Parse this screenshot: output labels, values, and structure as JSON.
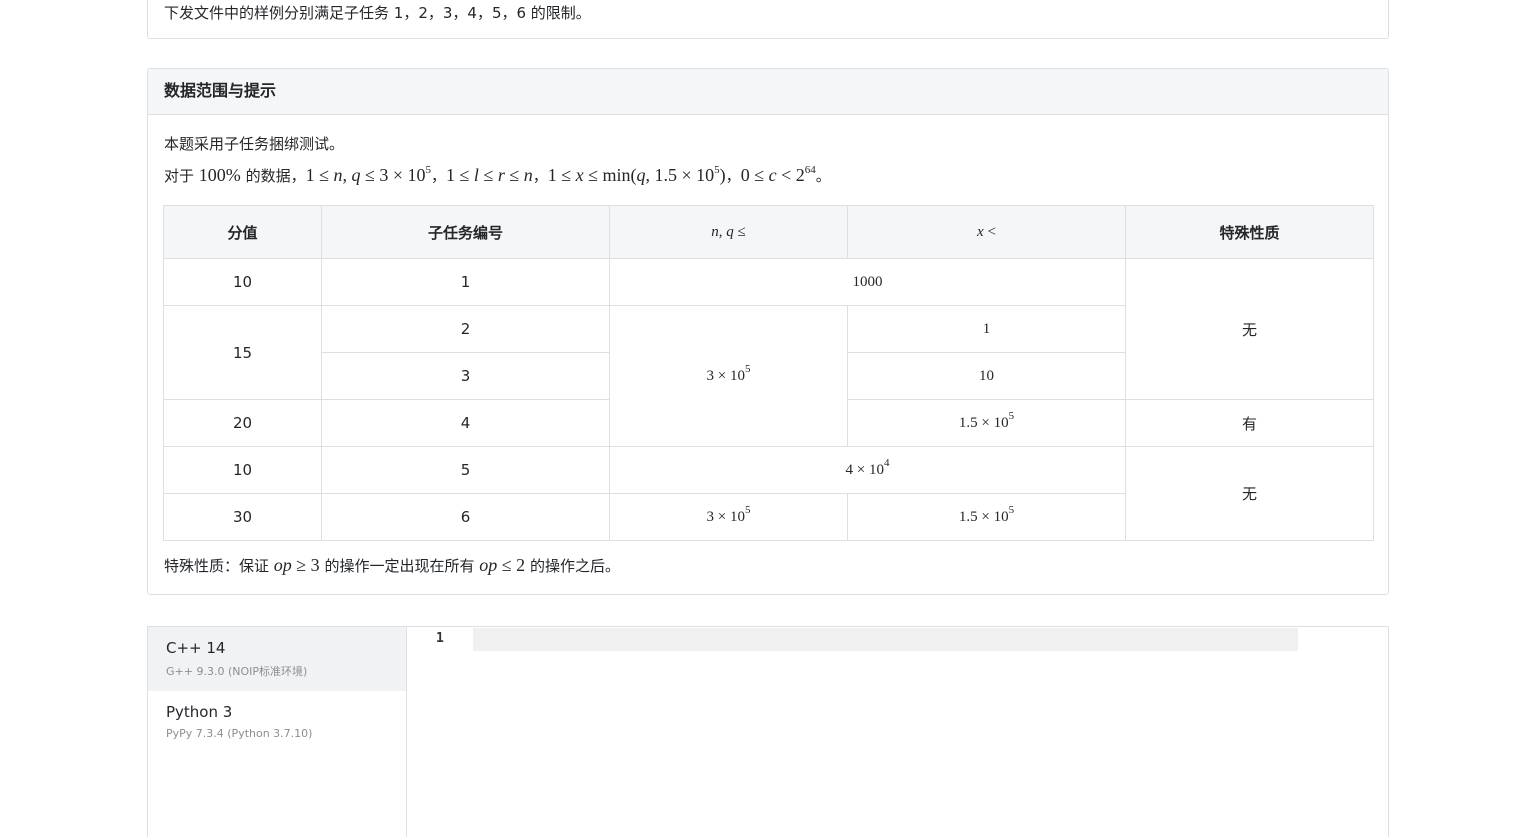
{
  "top_section": {
    "sample_note": "下发文件中的样例分别满足子任务 1，2，3，4，5，6 的限制。"
  },
  "data_range": {
    "heading": "数据范围与提示",
    "intro": "本题采用子任务捆绑测试。",
    "constraints_prefix": "对于",
    "constraints_percent": "100%",
    "constraints_mid": "的数据，",
    "special_note_prefix": "特殊性质：保证",
    "special_note_mid": "的操作一定出现在所有",
    "special_note_suffix": "的操作之后。",
    "table": {
      "headers": [
        "分值",
        "子任务编号",
        "n,q ≤",
        "x <",
        "特殊性质"
      ],
      "rows": [
        {
          "score": "10",
          "id": "1",
          "nq": "1000",
          "x": "",
          "special": "无"
        },
        {
          "score": "15",
          "id": "2",
          "nq": "3 × 10^5",
          "x": "1",
          "special": ""
        },
        {
          "score": "",
          "id": "3",
          "nq": "",
          "x": "10",
          "special": ""
        },
        {
          "score": "20",
          "id": "4",
          "nq": "",
          "x": "1.5 × 10^5",
          "special": "有"
        },
        {
          "score": "10",
          "id": "5",
          "nq": "4 × 10^4",
          "x": "",
          "special": "无"
        },
        {
          "score": "30",
          "id": "6",
          "nq": "3 × 10^5",
          "x": "1.5 × 10^5",
          "special": ""
        }
      ]
    }
  },
  "editor": {
    "languages": [
      {
        "name": "C++ 14",
        "version": "G++ 9.3.0 (NOIP标准环境)",
        "selected": true
      },
      {
        "name": "Python 3",
        "version": "PyPy 7.3.4 (Python 3.7.10)",
        "selected": false
      }
    ],
    "line_number": "1"
  }
}
